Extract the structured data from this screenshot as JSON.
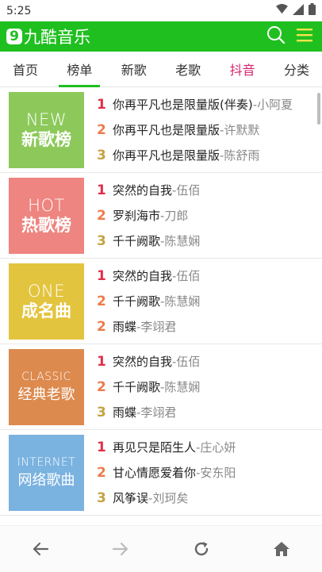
{
  "status_bar": {
    "time": "5:25"
  },
  "header": {
    "logo_badge": "9",
    "logo_text": "九酷音乐"
  },
  "tabs": [
    {
      "label": "首页"
    },
    {
      "label": "榜单"
    },
    {
      "label": "新歌"
    },
    {
      "label": "老歌"
    },
    {
      "label": "抖音"
    },
    {
      "label": "分类"
    }
  ],
  "cards": [
    {
      "en": "NEW",
      "cn": "新歌榜",
      "color": "#8cc95a",
      "songs": [
        {
          "rank": "1",
          "title": "你再平凡也是限量版(伴奏)",
          "artist": "-小阿夏"
        },
        {
          "rank": "2",
          "title": "你再平凡也是限量版",
          "artist": "-许默默"
        },
        {
          "rank": "3",
          "title": "你再平凡也是限量版",
          "artist": "-陈舒雨"
        }
      ]
    },
    {
      "en": "HOT",
      "cn": "热歌榜",
      "color": "#ee8580",
      "songs": [
        {
          "rank": "1",
          "title": "突然的自我",
          "artist": "-伍佰"
        },
        {
          "rank": "2",
          "title": "罗刹海市",
          "artist": "-刀郎"
        },
        {
          "rank": "3",
          "title": "千千阙歌",
          "artist": "-陈慧娴"
        }
      ]
    },
    {
      "en": "ONE",
      "cn": "成名曲",
      "color": "#e3c43e",
      "songs": [
        {
          "rank": "1",
          "title": "突然的自我",
          "artist": "-伍佰"
        },
        {
          "rank": "2",
          "title": "千千阙歌",
          "artist": "-陈慧娴"
        },
        {
          "rank": "2",
          "title": "雨蝶",
          "artist": "-李翊君"
        }
      ]
    },
    {
      "en": "CLASSIC",
      "cn": "经典老歌",
      "color": "#dd8a4e",
      "songs": [
        {
          "rank": "1",
          "title": "突然的自我",
          "artist": "-伍佰"
        },
        {
          "rank": "2",
          "title": "千千阙歌",
          "artist": "-陈慧娴"
        },
        {
          "rank": "3",
          "title": "雨蝶",
          "artist": "-李翊君"
        }
      ]
    },
    {
      "en": "INTERNET",
      "cn": "网络歌曲",
      "color": "#7ab2e0",
      "songs": [
        {
          "rank": "1",
          "title": "再见只是陌生人",
          "artist": "-庄心妍"
        },
        {
          "rank": "2",
          "title": "甘心情愿爱着你",
          "artist": "-安东阳"
        },
        {
          "rank": "3",
          "title": "风筝误",
          "artist": "-刘珂矣"
        }
      ]
    }
  ],
  "icons": {
    "wifi": "wifi-icon",
    "signal": "signal-icon",
    "battery": "battery-icon",
    "search": "search-icon",
    "menu": "menu-icon",
    "back": "back-arrow-icon",
    "forward": "forward-arrow-icon",
    "refresh": "refresh-icon",
    "home": "home-icon"
  },
  "colors": {
    "brand": "#1fbf1f",
    "hot_tab": "#d8256b",
    "rank1": "#e0304a",
    "rank2": "#ee7a4a",
    "rank3": "#c3a341"
  }
}
